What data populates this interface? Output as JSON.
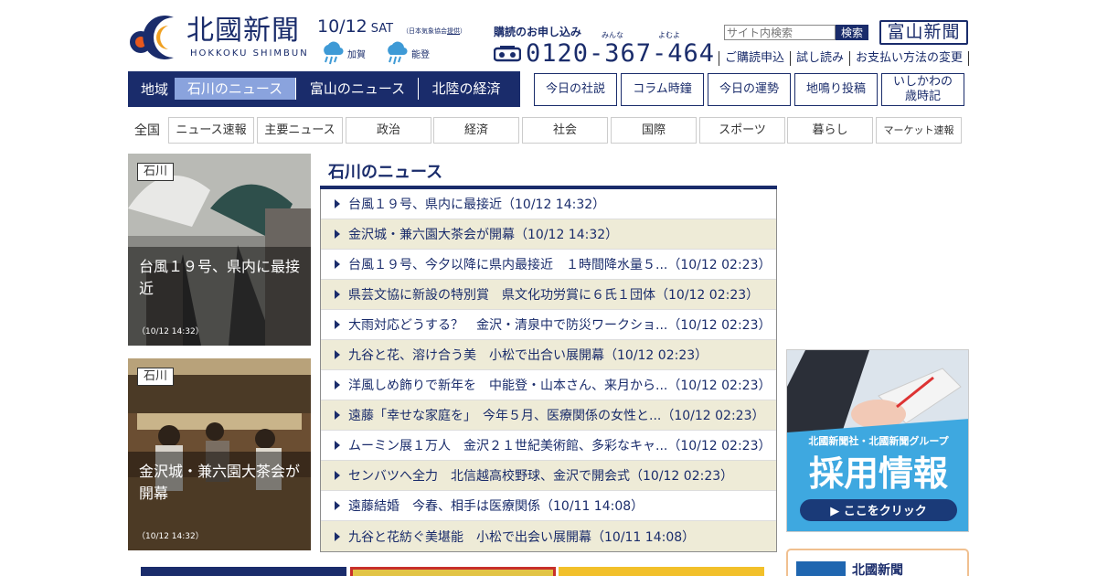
{
  "header": {
    "logo_name": "北國新聞",
    "logo_roman": "HOKKOKU SHIMBUN",
    "date": "10/12",
    "day_of_week": "SAT",
    "weather_note_prefix": "（日本気象協会",
    "weather_note_link": "提供",
    "weather_note_suffix": "）",
    "weather": [
      {
        "area": "加賀",
        "icon": "rain-icon"
      },
      {
        "area": "能登",
        "icon": "rain-icon"
      }
    ],
    "subscribe_heading": "購読のお申し込み",
    "phone": "0120-367-464",
    "phone_ruby": [
      "みんな",
      "よむよ"
    ],
    "search_placeholder": "サイト内検索",
    "search_button": "検索",
    "toyama_logo": "富山新聞",
    "util_links": [
      "ご購読申込",
      "試し読み",
      "お支払い方法の変更"
    ]
  },
  "region_nav": {
    "label": "地域",
    "tabs": [
      {
        "label": "石川のニュース",
        "active": true
      },
      {
        "label": "富山のニュース",
        "active": false
      },
      {
        "label": "北陸の経済",
        "active": false
      }
    ]
  },
  "column_buttons": [
    "今日の社説",
    "コラム時鐘",
    "今日の運勢",
    "地鳴り投稿",
    "いしかわの\n歳時記"
  ],
  "category_nav": {
    "first": "全国",
    "items": [
      "ニュース速報",
      "主要ニュース",
      "政治",
      "経済",
      "社会",
      "国際",
      "スポーツ",
      "暮らし",
      "マーケット速報"
    ]
  },
  "photo_cards": [
    {
      "tag": "石川",
      "title": "台風１９号、県内に最接近",
      "time": "（10/12 14:32）"
    },
    {
      "tag": "石川",
      "title": "金沢城・兼六園大茶会が開幕",
      "time": "（10/12 14:32）"
    }
  ],
  "news": {
    "heading": "石川のニュース",
    "items": [
      "台風１９号、県内に最接近（10/12 14:32）",
      "金沢城・兼六園大茶会が開幕（10/12 14:32）",
      "台風１９号、今夕以降に県内最接近　１時間降水量５...（10/12 02:23）",
      "県芸文協に新設の特別賞　県文化功労賞に６氏１団体（10/12 02:23）",
      "大雨対応どうする？　金沢・清泉中で防災ワークショ...（10/12 02:23）",
      "九谷と花、溶け合う美　小松で出合い展開幕（10/12 02:23）",
      "洋風しめ飾りで新年を　中能登・山本さん、来月から...（10/12 02:23）",
      "遠藤「幸せな家庭を」　今年５月、医療関係の女性と...（10/12 02:23）",
      "ムーミン展１万人　金沢２１世紀美術館、多彩なキャ...（10/12 02:23）",
      "センバツへ全力　北信越高校野球、金沢で開会式（10/12 02:23）",
      "遠藤結婚　今春、相手は医療関係（10/11 14:08）",
      "九谷と花紡ぐ美堪能　小松で出会い展開幕（10/11 14:08）"
    ]
  },
  "recruit_banner": {
    "subtitle": "北國新聞社・北國新聞グループ",
    "title": "採用情報",
    "button": "▶ ここをクリック"
  },
  "promo_box": {
    "title": "北國新聞"
  },
  "colors": {
    "brand": "#1a2c6b",
    "tab_active": "#8aa3dd",
    "row_alt": "#eeebd7",
    "recruit_bg": "#3ea8e0"
  }
}
